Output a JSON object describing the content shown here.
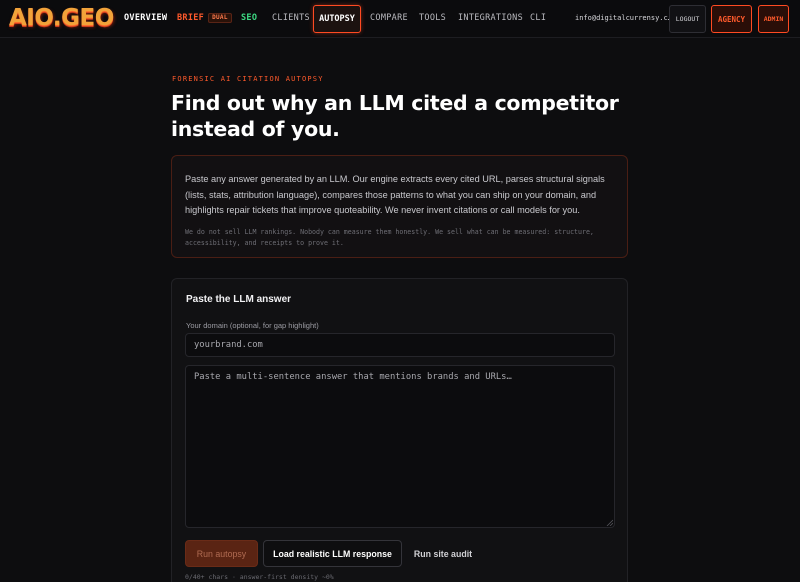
{
  "nav": {
    "logo": "AIO.GEO",
    "items": [
      {
        "label": "OVERVIEW"
      },
      {
        "label": "BRIEF",
        "badge": "DUAL"
      },
      {
        "label": "SEO"
      },
      {
        "label": "CLIENTS"
      },
      {
        "label": "AUTOPSY"
      },
      {
        "label": "COMPARE"
      },
      {
        "label": "TOOLS"
      },
      {
        "label": "INTEGRATIONS"
      },
      {
        "label": "CLI"
      }
    ],
    "email": "info@digitalcurrensy.c…",
    "logout": "LOGOUT",
    "agency": "AGENCY",
    "admin": "ADMIN"
  },
  "hero": {
    "eyebrow": "FORENSIC AI CITATION AUTOPSY",
    "headline": "Find out why an LLM cited a competitor instead of you."
  },
  "intro": {
    "text": "Paste any answer generated by an LLM. Our engine extracts every cited URL, parses structural signals (lists, stats, attribution language), compares those patterns to what you can ship on your domain, and highlights repair tickets that improve quoteability. We never invent citations or call models for you.",
    "note": "We do not sell LLM rankings. Nobody can measure them honestly. We sell what can be measured: structure, accessibility, and receipts to prove it."
  },
  "form": {
    "title": "Paste the LLM answer",
    "domain_label": "Your domain (optional, for gap highlight)",
    "domain_placeholder": "yourbrand.com",
    "answer_placeholder": "Paste a multi-sentence answer that mentions brands and URLs…",
    "run_label": "Run autopsy",
    "load_label": "Load realistic LLM response",
    "site_label": "Run site audit",
    "meta": "0/40+ chars · answer-first density ~0%"
  },
  "colors": {
    "accent": "#ff4a22",
    "seo": "#3ddc84",
    "background": "#0d0d0f"
  }
}
